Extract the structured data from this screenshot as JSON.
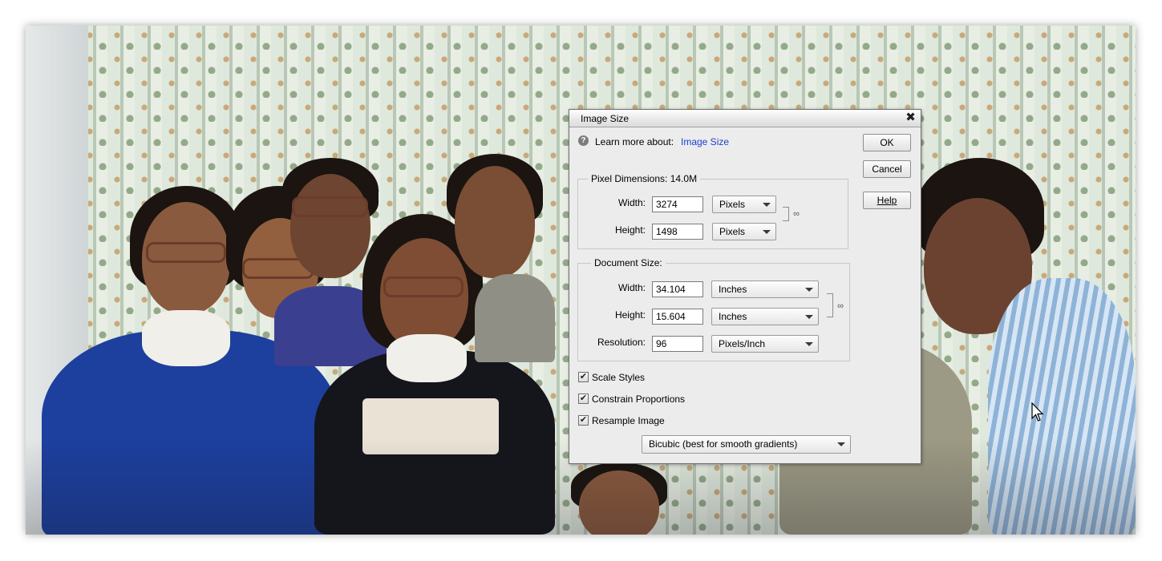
{
  "dialog": {
    "title": "Image Size",
    "learn_label": "Learn more about:",
    "learn_link": "Image Size",
    "buttons": {
      "ok": "OK",
      "cancel": "Cancel",
      "help": "Help"
    },
    "pixel_dimensions": {
      "legend": "Pixel Dimensions:",
      "size": "14.0M",
      "width_label": "Width:",
      "width_value": "3274",
      "width_unit": "Pixels",
      "height_label": "Height:",
      "height_value": "1498",
      "height_unit": "Pixels"
    },
    "document_size": {
      "legend": "Document Size:",
      "width_label": "Width:",
      "width_value": "34.104",
      "width_unit": "Inches",
      "height_label": "Height:",
      "height_value": "15.604",
      "height_unit": "Inches",
      "resolution_label": "Resolution:",
      "resolution_value": "96",
      "resolution_unit": "Pixels/Inch"
    },
    "checkboxes": [
      {
        "label": "Scale Styles",
        "checked": true
      },
      {
        "label": "Constrain Proportions",
        "checked": true
      },
      {
        "label": "Resample Image",
        "checked": true
      }
    ],
    "resample_method": "Bicubic (best for smooth gradients)"
  },
  "colors": {
    "link": "#1a3fcf",
    "dialog_bg": "#ececec"
  }
}
